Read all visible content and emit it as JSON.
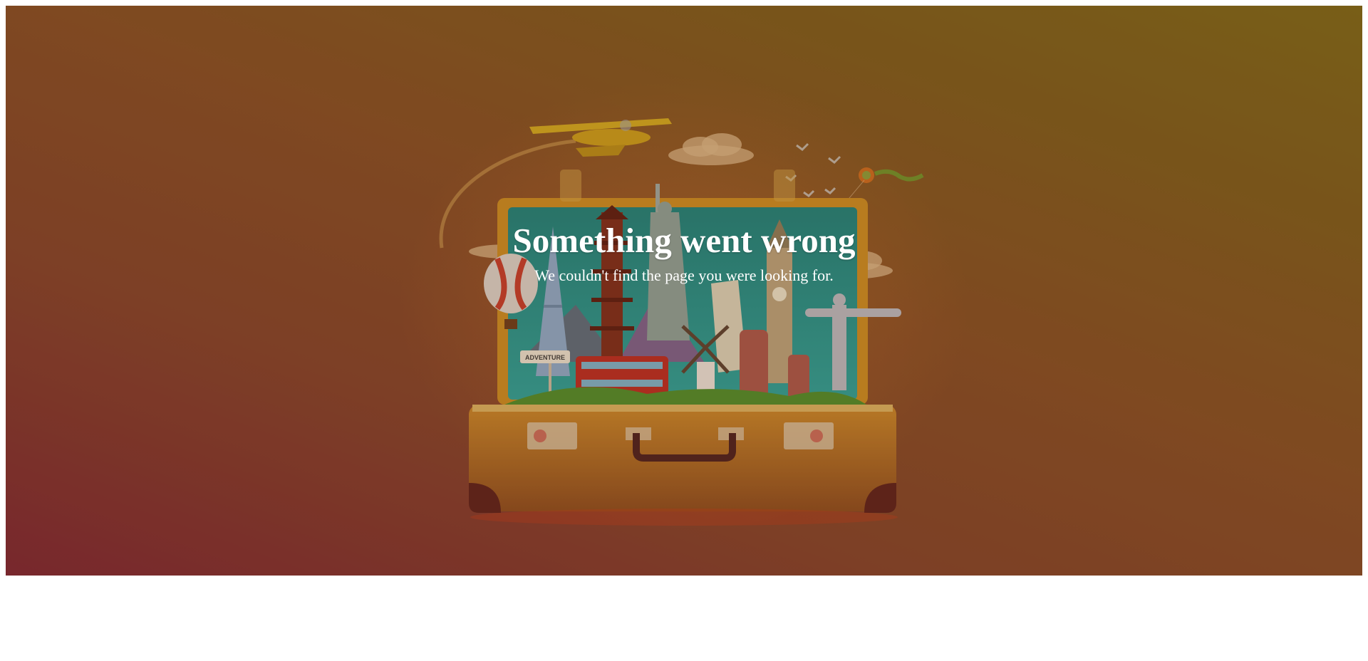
{
  "error_page": {
    "title": "Something went wrong",
    "message": "We couldn't find the page you were looking for.",
    "sign_text": "ADVENTURE"
  },
  "colors": {
    "background_gradient_start": "#7b2332",
    "background_gradient_end": "#7a6618",
    "title_text": "#ffffff",
    "suitcase": "#c87d22",
    "suitcase_inner": "#1f8f87"
  },
  "illustration": {
    "subject": "open travel suitcase with world landmarks",
    "elements": [
      "airplane-icon",
      "hot-air-balloon-icon",
      "eiffel-tower-icon",
      "pagoda-icon",
      "statue-of-liberty-icon",
      "leaning-tower-icon",
      "big-ben-icon",
      "christ-the-redeemer-icon",
      "double-decker-bus-icon",
      "windmill-icon",
      "moai-icon",
      "birds-icon",
      "kite-icon",
      "clouds-icon"
    ]
  }
}
